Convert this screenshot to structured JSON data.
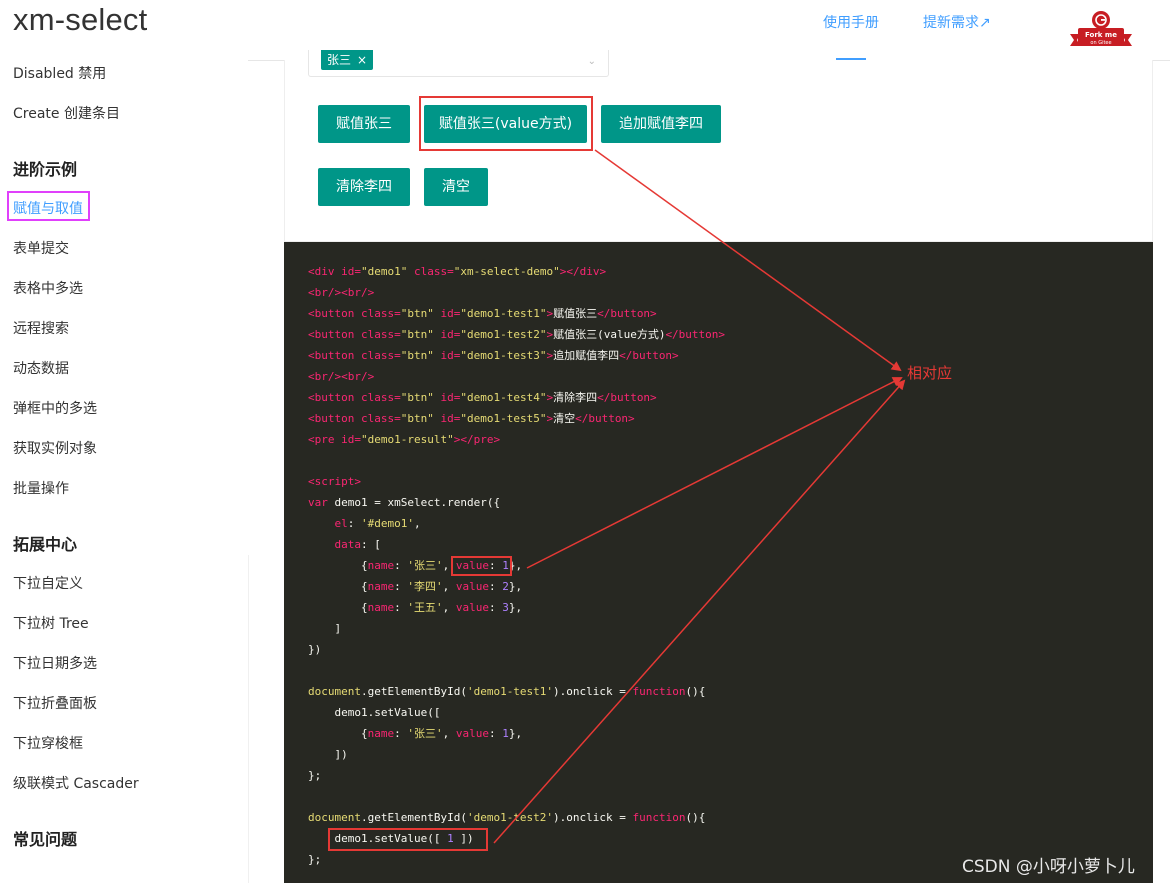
{
  "header": {
    "logo": "xm-select",
    "nav": [
      "使用手册",
      "提新需求↗"
    ],
    "fork_badge": {
      "line1": "Fork me",
      "line2": "on Gitee",
      "color": "#c71d23"
    }
  },
  "sidebar": {
    "items_top": [
      "Disabled 禁用",
      "Create 创建条目"
    ],
    "section1": "进阶示例",
    "items1": [
      "赋值与取值",
      "表单提交",
      "表格中多选",
      "远程搜索",
      "动态数据",
      "弹框中的多选",
      "获取实例对象",
      "批量操作"
    ],
    "section2": "拓展中心",
    "items2": [
      "下拉自定义",
      "下拉树 Tree",
      "下拉日期多选",
      "下拉折叠面板",
      "下拉穿梭框",
      "级联模式 Cascader"
    ],
    "section3": "常见问题"
  },
  "demo": {
    "selected_tag": "张三",
    "tag_close": "×",
    "buttons": [
      "赋值张三",
      "赋值张三(value方式)",
      "追加赋值李四",
      "清除李四",
      "清空"
    ]
  },
  "code": [
    [
      [
        "tag",
        "<div "
      ],
      [
        "attr",
        "id="
      ],
      [
        "str",
        "\"demo1\""
      ],
      [
        "p",
        " "
      ],
      [
        "attr",
        "class="
      ],
      [
        "str",
        "\"xm-select-demo\""
      ],
      [
        "tag",
        "></div>"
      ]
    ],
    [
      [
        "tag",
        "<br/><br/>"
      ]
    ],
    [
      [
        "tag",
        "<button "
      ],
      [
        "attr",
        "class="
      ],
      [
        "str",
        "\"btn\""
      ],
      [
        "p",
        " "
      ],
      [
        "attr",
        "id="
      ],
      [
        "str",
        "\"demo1-test1\""
      ],
      [
        "tag",
        ">"
      ],
      [
        "p",
        "赋值张三"
      ],
      [
        "tag",
        "</button>"
      ]
    ],
    [
      [
        "tag",
        "<button "
      ],
      [
        "attr",
        "class="
      ],
      [
        "str",
        "\"btn\""
      ],
      [
        "p",
        " "
      ],
      [
        "attr",
        "id="
      ],
      [
        "str",
        "\"demo1-test2\""
      ],
      [
        "tag",
        ">"
      ],
      [
        "p",
        "赋值张三(value方式)"
      ],
      [
        "tag",
        "</button>"
      ]
    ],
    [
      [
        "tag",
        "<button "
      ],
      [
        "attr",
        "class="
      ],
      [
        "str",
        "\"btn\""
      ],
      [
        "p",
        " "
      ],
      [
        "attr",
        "id="
      ],
      [
        "str",
        "\"demo1-test3\""
      ],
      [
        "tag",
        ">"
      ],
      [
        "p",
        "追加赋值李四"
      ],
      [
        "tag",
        "</button>"
      ]
    ],
    [
      [
        "tag",
        "<br/><br/>"
      ]
    ],
    [
      [
        "tag",
        "<button "
      ],
      [
        "attr",
        "class="
      ],
      [
        "str",
        "\"btn\""
      ],
      [
        "p",
        " "
      ],
      [
        "attr",
        "id="
      ],
      [
        "str",
        "\"demo1-test4\""
      ],
      [
        "tag",
        ">"
      ],
      [
        "p",
        "清除李四"
      ],
      [
        "tag",
        "</button>"
      ]
    ],
    [
      [
        "tag",
        "<button "
      ],
      [
        "attr",
        "class="
      ],
      [
        "str",
        "\"btn\""
      ],
      [
        "p",
        " "
      ],
      [
        "attr",
        "id="
      ],
      [
        "str",
        "\"demo1-test5\""
      ],
      [
        "tag",
        ">"
      ],
      [
        "p",
        "清空"
      ],
      [
        "tag",
        "</button>"
      ]
    ],
    [
      [
        "tag",
        "<pre "
      ],
      [
        "attr",
        "id="
      ],
      [
        "str",
        "\"demo1-result\""
      ],
      [
        "tag",
        "></pre>"
      ]
    ],
    [],
    [
      [
        "tag",
        "<script>"
      ]
    ],
    [
      [
        "kw",
        "var"
      ],
      [
        "p",
        " demo1 = xmSelect.render({"
      ]
    ],
    [
      [
        "p",
        "    "
      ],
      [
        "key",
        "el"
      ],
      [
        "p",
        ": "
      ],
      [
        "str",
        "'#demo1'"
      ],
      [
        "p",
        ","
      ]
    ],
    [
      [
        "p",
        "    "
      ],
      [
        "key",
        "data"
      ],
      [
        "p",
        ": ["
      ]
    ],
    [
      [
        "p",
        "        {"
      ],
      [
        "key",
        "name"
      ],
      [
        "p",
        ": "
      ],
      [
        "str",
        "'张三'"
      ],
      [
        "p",
        ", "
      ],
      [
        "key",
        "value"
      ],
      [
        "p",
        ": "
      ],
      [
        "num",
        "1"
      ],
      [
        "p",
        "},"
      ]
    ],
    [
      [
        "p",
        "        {"
      ],
      [
        "key",
        "name"
      ],
      [
        "p",
        ": "
      ],
      [
        "str",
        "'李四'"
      ],
      [
        "p",
        ", "
      ],
      [
        "key",
        "value"
      ],
      [
        "p",
        ": "
      ],
      [
        "num",
        "2"
      ],
      [
        "p",
        "},"
      ]
    ],
    [
      [
        "p",
        "        {"
      ],
      [
        "key",
        "name"
      ],
      [
        "p",
        ": "
      ],
      [
        "str",
        "'王五'"
      ],
      [
        "p",
        ", "
      ],
      [
        "key",
        "value"
      ],
      [
        "p",
        ": "
      ],
      [
        "num",
        "3"
      ],
      [
        "p",
        "},"
      ]
    ],
    [
      [
        "p",
        "    ]"
      ]
    ],
    [
      [
        "p",
        "})"
      ]
    ],
    [],
    [
      [
        "fn",
        "document"
      ],
      [
        "p",
        ".getElementById("
      ],
      [
        "str",
        "'demo1-test1'"
      ],
      [
        "p",
        ").onclick = "
      ],
      [
        "kw",
        "function"
      ],
      [
        "p",
        "(){"
      ]
    ],
    [
      [
        "p",
        "    demo1.setValue(["
      ]
    ],
    [
      [
        "p",
        "        {"
      ],
      [
        "key",
        "name"
      ],
      [
        "p",
        ": "
      ],
      [
        "str",
        "'张三'"
      ],
      [
        "p",
        ", "
      ],
      [
        "key",
        "value"
      ],
      [
        "p",
        ": "
      ],
      [
        "num",
        "1"
      ],
      [
        "p",
        "},"
      ]
    ],
    [
      [
        "p",
        "    ])"
      ]
    ],
    [
      [
        "p",
        "};"
      ]
    ],
    [],
    [
      [
        "fn",
        "document"
      ],
      [
        "p",
        ".getElementById("
      ],
      [
        "str",
        "'demo1-test2'"
      ],
      [
        "p",
        ").onclick = "
      ],
      [
        "kw",
        "function"
      ],
      [
        "p",
        "(){"
      ]
    ],
    [
      [
        "p",
        "    demo1.setValue([ "
      ],
      [
        "num",
        "1"
      ],
      [
        "p",
        " ])"
      ]
    ],
    [
      [
        "p",
        "};"
      ]
    ]
  ],
  "syntax_colors": {
    "tag": "#f92672",
    "attr": "#f92672",
    "str": "#e6db74",
    "kw": "#f92672",
    "key": "#f92672",
    "num": "#ae81ff",
    "fn": "#e6db74",
    "p": "#f8f8f2"
  },
  "annotation": "相对应",
  "watermark": "CSDN @小呀小萝卜儿",
  "colors": {
    "accent": "#009688",
    "link": "#409eff",
    "highlight": "#e53935",
    "active_box": "#e040fb",
    "code_bg": "#272822"
  }
}
